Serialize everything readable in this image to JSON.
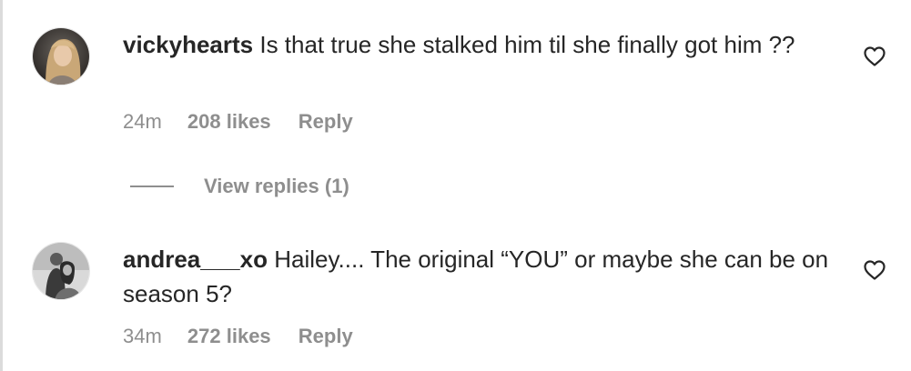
{
  "comments": [
    {
      "username": "vickyhearts",
      "text": "Is that true she stalked him til she finally got him ??",
      "time": "24m",
      "likes": "208 likes",
      "reply": "Reply",
      "avatar_icon": "profile-photo-blonde-woman",
      "like_icon": "heart-outline-icon"
    },
    {
      "username": "andrea___xo",
      "text": "Hailey.... The original “YOU” or maybe she can be on season 5?",
      "time": "34m",
      "likes": "272 likes",
      "reply": "Reply",
      "avatar_icon": "profile-photo-couple-bw",
      "like_icon": "heart-outline-icon"
    }
  ],
  "view_replies": {
    "label": "View replies (1)"
  },
  "colors": {
    "text_primary": "#262626",
    "text_secondary": "#8e8e8e",
    "background": "#ffffff"
  }
}
